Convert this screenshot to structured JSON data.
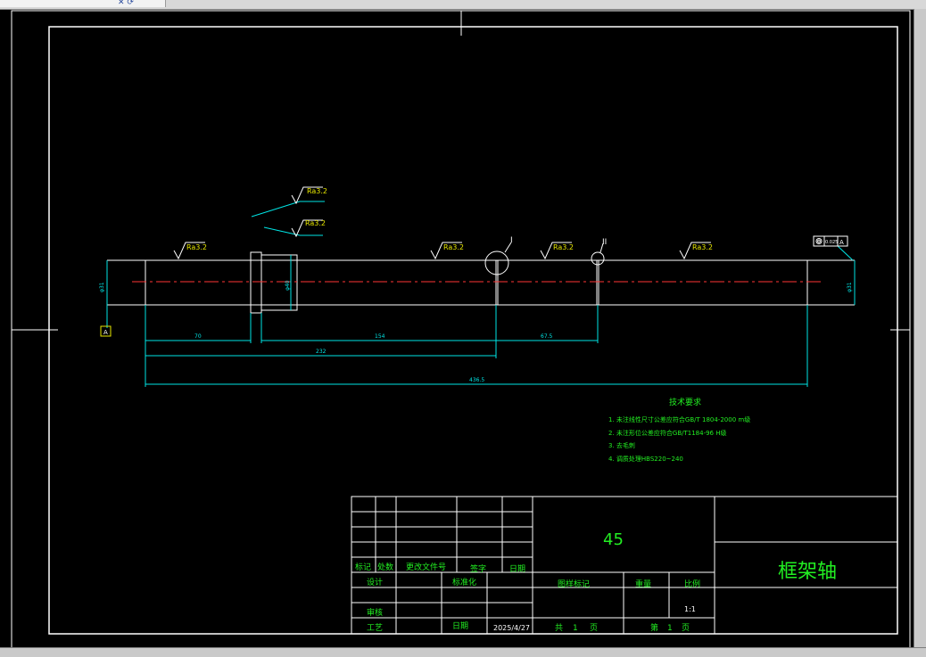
{
  "window": {
    "tab_icons": "✕ ⟳"
  },
  "annotations": {
    "ra32": "Ra3.2",
    "datum_a": "A",
    "gdt_tolerance": "0.025",
    "detail_1": "I",
    "detail_2": "II"
  },
  "dimensions": {
    "d70": "70",
    "d154": "154",
    "d67_5": "67.5",
    "d232": "232",
    "d436_5": "436.5",
    "dia_left": "φ31",
    "dia_collar": "φ40",
    "dia_right": "φ31"
  },
  "tech_requirements": {
    "title": "技术要求",
    "items": [
      "1. 未注线性尺寸公差应符合GB/T 1804-2000 m级",
      "2. 未注形位公差应符合GB/T1184-96 H级",
      "3. 去毛刺",
      "4. 调质处理HBS220~240"
    ]
  },
  "title_block": {
    "material": "45",
    "part_name": "框架轴",
    "labels": {
      "mark": "标记",
      "count": "处数",
      "change_doc": "更改文件号",
      "signature": "签字",
      "date": "日期",
      "design": "设计",
      "standardize": "标准化",
      "review": "审核",
      "process": "工艺",
      "date2": "日期",
      "stage_mark": "图样标记",
      "weight": "重量",
      "scale": "比例",
      "total_prefix": "共",
      "total_num": "1",
      "page_suffix": "页",
      "sheet_prefix": "第",
      "sheet_num": "1",
      "sheet_suffix": "页"
    },
    "scale_value": "1:1",
    "date_value": "2025/4/27"
  },
  "colors": {
    "background": "#000000",
    "outline": "#ffffff",
    "dimension": "#00e5e5",
    "centerline": "#ff3333",
    "text_green": "#22ee22",
    "roughness_yellow": "#e6e600"
  }
}
